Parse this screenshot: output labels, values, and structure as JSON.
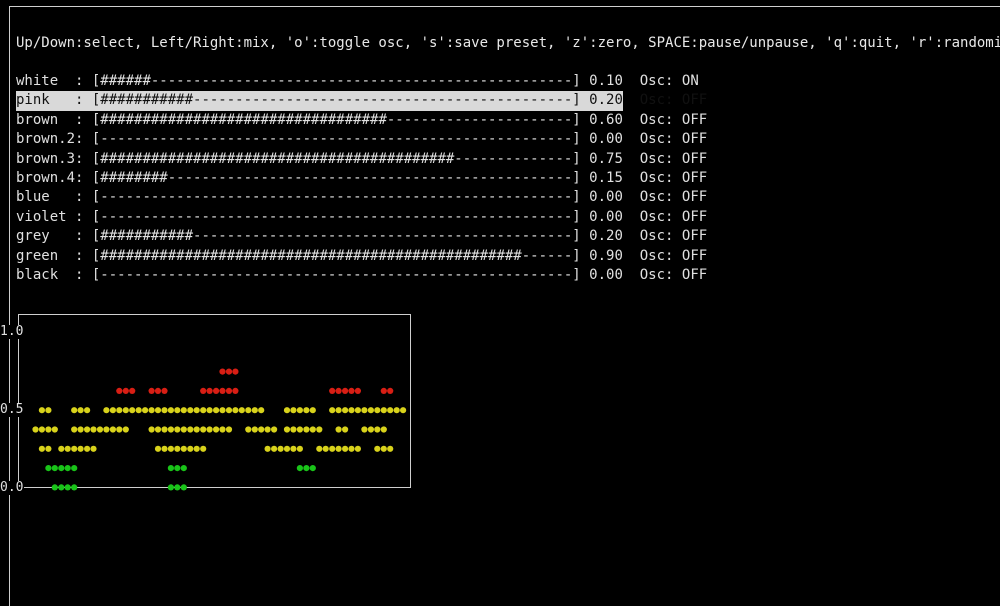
{
  "help_text": "Up/Down:select, Left/Right:mix, 'o':toggle osc, 's':save preset, 'z':zero, SPACE:pause/unpause, 'q':quit, 'r':randomize",
  "bar_width": 56,
  "selected_index": 1,
  "channels": [
    {
      "name": "white  ",
      "level": 0.1,
      "level_text": "0.10",
      "osc": "ON"
    },
    {
      "name": "pink   ",
      "level": 0.2,
      "level_text": "0.20",
      "osc": "OFF"
    },
    {
      "name": "brown  ",
      "level": 0.6,
      "level_text": "0.60",
      "osc": "OFF"
    },
    {
      "name": "brown.2",
      "level": 0.0,
      "level_text": "0.00",
      "osc": "OFF"
    },
    {
      "name": "brown.3",
      "level": 0.75,
      "level_text": "0.75",
      "osc": "OFF"
    },
    {
      "name": "brown.4",
      "level": 0.15,
      "level_text": "0.15",
      "osc": "OFF"
    },
    {
      "name": "blue   ",
      "level": 0.0,
      "level_text": "0.00",
      "osc": "OFF"
    },
    {
      "name": "violet ",
      "level": 0.0,
      "level_text": "0.00",
      "osc": "OFF"
    },
    {
      "name": "grey   ",
      "level": 0.2,
      "level_text": "0.20",
      "osc": "OFF"
    },
    {
      "name": "green  ",
      "level": 0.9,
      "level_text": "0.90",
      "osc": "OFF"
    },
    {
      "name": "black  ",
      "level": 0.0,
      "level_text": "0.00",
      "osc": "OFF"
    }
  ],
  "osc_prefix": "Osc: ",
  "meter": {
    "y_top_label": "1.0",
    "y_mid_label": "0.5",
    "y_bottom_label": "0.0",
    "colors": {
      "low": "#19c419",
      "mid": "#d8d21b",
      "high": "#d81e14"
    },
    "rows": [
      "...........................................................",
      "...........................................................",
      "..............................RRR..........................",
      "..............RRR..RRR.....RRRRRR..............RRRRR...RR..",
      "..YY...YYY..YYYYYYYYYYYYYYYYYYYYYYYYY...YYYYY..YYYYYYYYYYYY",
      ".YYYY..YYYYYYYYY...YYYYYYYYYYYYY..YYYYY.YYYYYY..YY..YYYY....",
      "..YY.YYYYYY.........YYYYYYYY.........YYYYYY..YYYYYYY..YYY..",
      "...GGGGG..............GGG.................GGG..............",
      "....GGGG..............GGG..................................",
      "..........................................................."
    ]
  }
}
